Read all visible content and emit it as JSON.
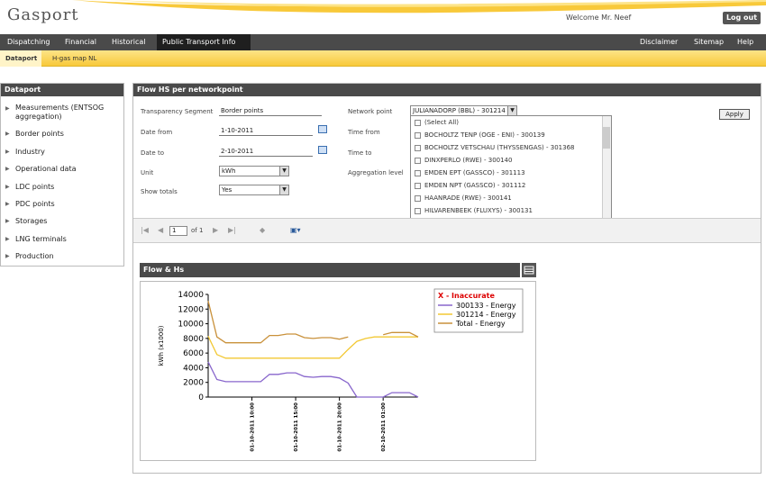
{
  "app": {
    "logo": "Gasport",
    "welcome": "Welcome Mr. Neef",
    "logout_label": "Log out"
  },
  "topnav": {
    "left": [
      "Dispatching",
      "Financial",
      "Historical",
      "Public Transport Info"
    ],
    "active": "Public Transport Info",
    "right": [
      "Disclaimer",
      "Sitemap",
      "Help"
    ]
  },
  "subnav": {
    "items": [
      "Dataport",
      "H-gas map NL"
    ],
    "active": "Dataport"
  },
  "sidebar": {
    "title": "Dataport",
    "items": [
      "Measurements (ENTSOG aggregation)",
      "Border points",
      "Industry",
      "Operational data",
      "LDC points",
      "PDC points",
      "Storages",
      "LNG terminals",
      "Production"
    ]
  },
  "panel": {
    "title": "Flow HS per networkpoint",
    "form": {
      "transparency_segment_label": "Transparency Segment",
      "transparency_segment_value": "Border points",
      "date_from_label": "Date from",
      "date_from_value": "1-10-2011",
      "date_to_label": "Date to",
      "date_to_value": "2-10-2011",
      "unit_label": "Unit",
      "unit_value": "kWh",
      "show_totals_label": "Show totals",
      "show_totals_value": "Yes",
      "network_point_label": "Network point",
      "network_point_value": "JULIANADORP (BBL) - 301214",
      "time_from_label": "Time from",
      "time_to_label": "Time to",
      "aggregation_level_label": "Aggregation level",
      "apply_label": "Apply"
    },
    "network_options": [
      "(Select All)",
      "BOCHOLTZ TENP (OGE - ENI) - 300139",
      "BOCHOLTZ VETSCHAU (THYSSENGAS) - 301368",
      "DINXPERLO (RWE) - 300140",
      "EMDEN EPT (GASSCO) - 301113",
      "EMDEN NPT (GASSCO) - 301112",
      "HAANRADE (RWE) - 300141",
      "HILVARENBEEK (FLUXYS) - 300131"
    ],
    "pager": {
      "page": "1",
      "of_label": "of 1"
    }
  },
  "chart_panel": {
    "title": "Flow & Hs"
  },
  "chart_data": {
    "type": "line",
    "ylabel": "kWh (x1000)",
    "ylim": [
      0,
      14000
    ],
    "yticks": [
      "14000",
      "12000",
      "10000",
      "8000",
      "6000",
      "4000",
      "2000",
      "0"
    ],
    "x_ticks": [
      {
        "label": "01-10-2011 10:00",
        "index": 5
      },
      {
        "label": "01-10-2011 15:00",
        "index": 10
      },
      {
        "label": "01-10-2011 20:00",
        "index": 15
      },
      {
        "label": "02-10-2011 01:00",
        "index": 20
      }
    ],
    "legend_title": "X - Inaccurate",
    "legend_title_color": "#dd0000",
    "legend_position": "top-right",
    "series": [
      {
        "name": "300133 - Energy",
        "color": "#8866cc",
        "values": [
          4800,
          2400,
          2100,
          2100,
          2100,
          2100,
          2100,
          3100,
          3100,
          3300,
          3300,
          2800,
          2700,
          2800,
          2800,
          2600,
          1900,
          0,
          0,
          0,
          0,
          600,
          600,
          600,
          0
        ]
      },
      {
        "name": "301214 - Energy",
        "color": "#f2c833",
        "values": [
          8300,
          5800,
          5300,
          5300,
          5300,
          5300,
          5300,
          5300,
          5300,
          5300,
          5300,
          5300,
          5300,
          5300,
          5300,
          5300,
          6500,
          7600,
          8000,
          8200,
          8200,
          8200,
          8200,
          8200,
          8200
        ]
      },
      {
        "name": "Total - Energy",
        "color": "#c9913b",
        "values": [
          13100,
          8200,
          7400,
          7400,
          7400,
          7400,
          7400,
          8400,
          8400,
          8600,
          8600,
          8100,
          8000,
          8100,
          8100,
          7900,
          8200,
          null,
          null,
          null,
          8500,
          8800,
          8800,
          8800,
          8200
        ]
      }
    ]
  }
}
